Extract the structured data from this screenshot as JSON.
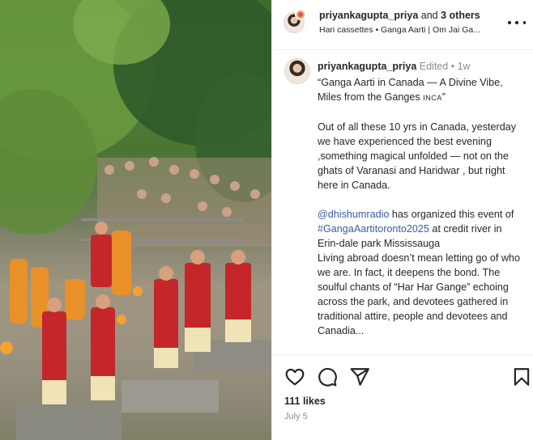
{
  "header": {
    "username": "priyankagupta_priya",
    "and_text": "and",
    "others_text": "3 others",
    "audio": "Hari cassettes • Ganga Aarti | Om Jai Ga..."
  },
  "caption": {
    "username": "priyankagupta_priya",
    "edited": "Edited",
    "bullet": "•",
    "age": "1w",
    "title": "“Ganga Aarti in Canada — A Divine Vibe, Miles from the Ganges",
    "title_tag": "INCA",
    "title_close": "”",
    "para1": "Out of all these 10 yrs in Canada, yesterday we have experienced  the best evening ,something magical unfolded — not on the ghats of Varanasi and Haridwar , but right here in Canada.",
    "mention": "@dhishumradio",
    "para2_a": " has organized this event of ",
    "hashtag": "#GangaAartitoronto2025",
    "para2_b": " at credit river in Erin-dale park Mississauga",
    "para3": "Living abroad doesn’t mean letting go of who we are. In fact, it deepens the bond. The soulful chants of “Har Har Gange” echoing across the park, and devotees gathered in traditional attire, people and devotees and Canadia..."
  },
  "footer": {
    "likes": "111 likes",
    "date": "July 5"
  },
  "icons": {
    "like": "heart-icon",
    "comment": "comment-icon",
    "share": "send-icon",
    "save": "bookmark-icon",
    "more": "more-icon"
  }
}
